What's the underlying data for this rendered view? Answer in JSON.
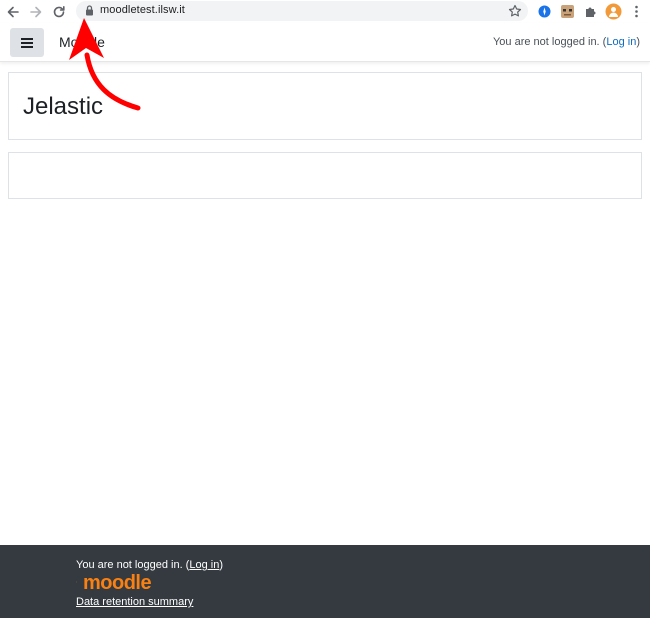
{
  "browser": {
    "url": "moodletest.ilsw.it",
    "icons": {
      "back": "arrow-left-icon",
      "forward": "arrow-right-icon",
      "reload": "reload-icon",
      "lock": "lock-icon",
      "bookmark": "star-icon",
      "menu": "kebab-menu-icon"
    }
  },
  "navbar": {
    "site_name": "Moodle",
    "login_prefix": "You are not logged in. (",
    "login_link": "Log in",
    "login_suffix": ")"
  },
  "page": {
    "title": "Jelastic"
  },
  "footer": {
    "login_prefix": "You are not logged in. (",
    "login_link": "Log in",
    "login_suffix": ")",
    "logo_text": "moodle",
    "data_retention_link": "Data retention summary"
  },
  "colors": {
    "annotation_arrow": "#ff0000",
    "footer_bg": "#343a40",
    "link": "#0f6cbf",
    "moodle_orange": "#f98012"
  }
}
